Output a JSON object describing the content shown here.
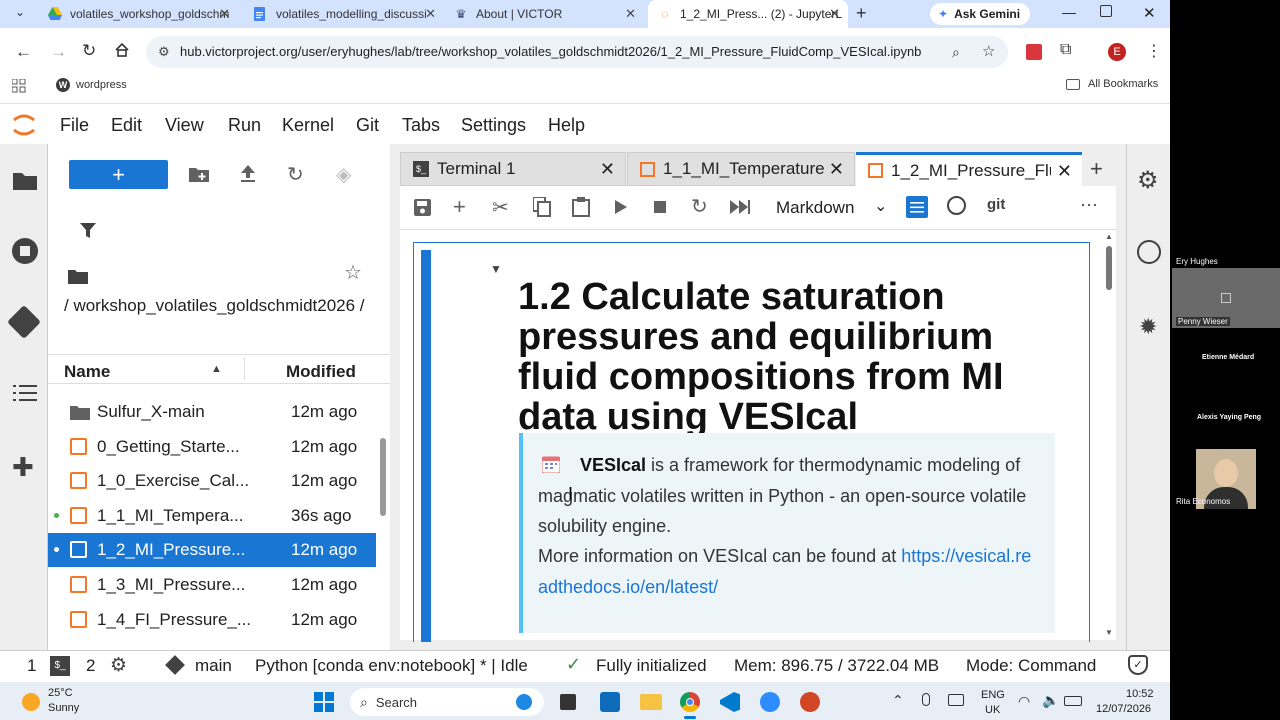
{
  "browser": {
    "tabs": [
      {
        "title": "volatiles_workshop_goldschm",
        "icon": "google-drive-icon"
      },
      {
        "title": "volatiles_modelling_discussi",
        "icon": "google-docs-icon"
      },
      {
        "title": "About | VICTOR",
        "icon": "victor-icon"
      },
      {
        "title": "1_2_MI_Press... (2) - JupyterL",
        "icon": "jupyter-icon"
      }
    ],
    "new_tab": "+",
    "gemini": "Ask Gemini",
    "url": "hub.victorproject.org/user/eryhughes/lab/tree/workshop_volatiles_goldschmidt2026/1_2_MI_Pressure_FluidComp_VESIcal.ipynb",
    "profile_initial": "E",
    "bookmark": "wordpress",
    "all_bookmarks": "All Bookmarks"
  },
  "menubar": [
    "File",
    "Edit",
    "View",
    "Run",
    "Kernel",
    "Git",
    "Tabs",
    "Settings",
    "Help"
  ],
  "filebrowser": {
    "new_button": "+",
    "path": "/ workshop_volatiles_goldschmidt2026 /",
    "col_name": "Name",
    "col_modified": "Modified",
    "rows": [
      {
        "name": "Sulfur_X-main",
        "modified": "12m ago",
        "type": "folder"
      },
      {
        "name": "0_Getting_Starte...",
        "modified": "12m ago",
        "type": "notebook"
      },
      {
        "name": "1_0_Exercise_Cal...",
        "modified": "12m ago",
        "type": "notebook"
      },
      {
        "name": "1_1_MI_Tempera...",
        "modified": "36s ago",
        "type": "notebook"
      },
      {
        "name": "1_2_MI_Pressure...",
        "modified": "12m ago",
        "type": "notebook"
      },
      {
        "name": "1_3_MI_Pressure...",
        "modified": "12m ago",
        "type": "notebook"
      },
      {
        "name": "1_4_FI_Pressure_...",
        "modified": "12m ago",
        "type": "notebook"
      }
    ]
  },
  "doc_tabs": [
    {
      "title": "Terminal 1"
    },
    {
      "title": "1_1_MI_Temperature"
    },
    {
      "title": "1_2_MI_Pressure_Flu"
    }
  ],
  "notebook_toolbar": {
    "cell_type": "Markdown",
    "git": "git"
  },
  "notebook": {
    "heading": "1.2 Calculate saturation pressures and equilibrium fluid compositions from MI data using VESIcal",
    "note_bold": "VESIcal",
    "note_text": " is a framework for thermodynamic modeling of magmatic volatiles written in Python - an open-source volatile solubility engine.",
    "note_more": "More information on VESIcal can be found at ",
    "note_link": "https://vesical.readthedocs.io/en/latest/"
  },
  "statusbar": {
    "num1": "1",
    "num2": "2",
    "branch": "main",
    "kernel": "Python [conda env:notebook] * | Idle",
    "init": "Fully initialized",
    "mem": "Mem: 896.75 / 3722.04 MB",
    "mode": "Mode: Command"
  },
  "taskbar": {
    "temp": "25°C",
    "weather": "Sunny",
    "search": "Search",
    "lang1": "ENG",
    "lang2": "UK",
    "time": "10:52",
    "date": "12/07/2026"
  },
  "video": {
    "participants": [
      "Ery Hughes",
      "Penny Wieser",
      "Etienne Médard",
      "Alexis Yaying Peng",
      "Rita Economos"
    ]
  }
}
